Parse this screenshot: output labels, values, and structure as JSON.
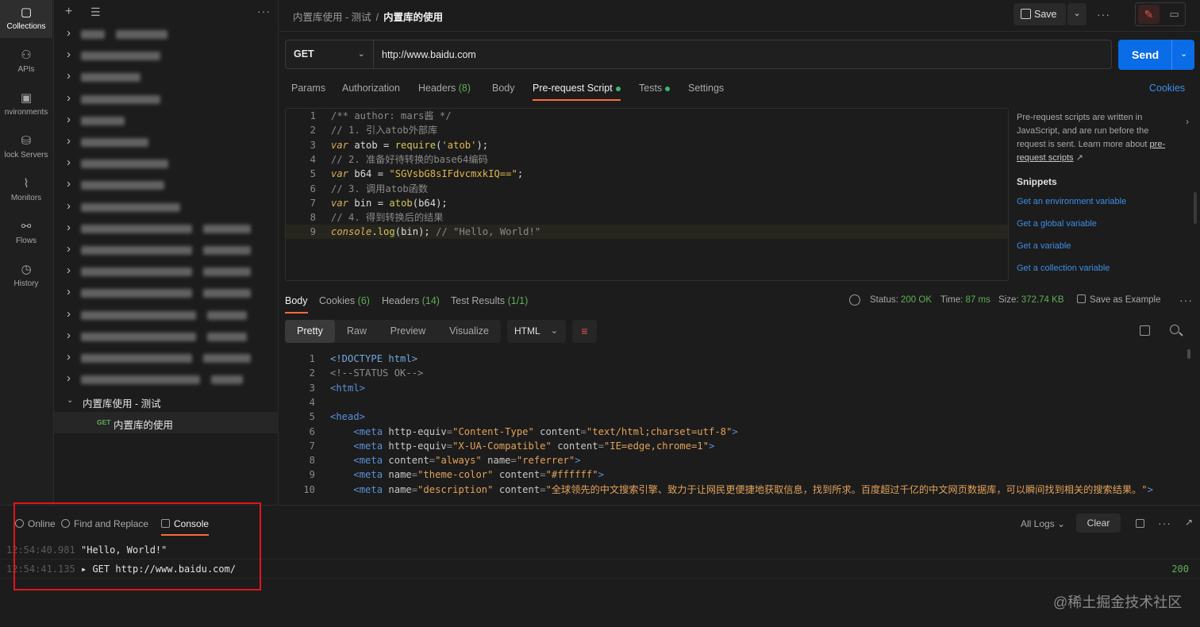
{
  "rail": [
    {
      "label": "Collections",
      "icon": "collections-icon",
      "active": true
    },
    {
      "label": "APIs",
      "icon": "apis-icon"
    },
    {
      "label": "nvironments",
      "icon": "environments-icon"
    },
    {
      "label": "lock Servers",
      "icon": "mock-servers-icon"
    },
    {
      "label": "Monitors",
      "icon": "monitors-icon"
    },
    {
      "label": "Flows",
      "icon": "flows-icon"
    },
    {
      "label": "History",
      "icon": "history-icon"
    }
  ],
  "sidebar": {
    "collection_name": "内置库使用 - 测试",
    "request": {
      "method": "GET",
      "name": "内置库的使用"
    }
  },
  "header": {
    "breadcrumb_parent": "内置库使用 - 测试",
    "breadcrumb_sep": "/",
    "breadcrumb_current": "内置库的使用",
    "save_label": "Save"
  },
  "request": {
    "method": "GET",
    "url": "http://www.baidu.com",
    "send_label": "Send",
    "tabs": [
      {
        "label": "Params"
      },
      {
        "label": "Authorization"
      },
      {
        "label": "Headers",
        "count": "(8)"
      },
      {
        "label": "Body"
      },
      {
        "label": "Pre-request Script",
        "active": true,
        "dot": true
      },
      {
        "label": "Tests",
        "dot": true
      },
      {
        "label": "Settings"
      }
    ],
    "cookies_label": "Cookies"
  },
  "script_lines": [
    {
      "n": "1",
      "parts": [
        [
          "c-com",
          "/** author: mars酱 */"
        ]
      ]
    },
    {
      "n": "2",
      "parts": [
        [
          "c-com",
          "// 1. 引入atob外部库"
        ]
      ]
    },
    {
      "n": "3",
      "parts": [
        [
          "c-kw",
          "var"
        ],
        [
          "c-def",
          " atob = "
        ],
        [
          "c-fn",
          "require"
        ],
        [
          "c-def",
          "("
        ],
        [
          "c-str",
          "'atob'"
        ],
        [
          "c-def",
          ");"
        ]
      ]
    },
    {
      "n": "4",
      "parts": [
        [
          "c-com",
          "// 2. 准备好待转换的base64编码"
        ]
      ]
    },
    {
      "n": "5",
      "parts": [
        [
          "c-kw",
          "var"
        ],
        [
          "c-def",
          " b64 = "
        ],
        [
          "c-str",
          "\"SGVsbG8sIFdvcmxkIQ==\""
        ],
        [
          "c-def",
          ";"
        ]
      ]
    },
    {
      "n": "6",
      "parts": [
        [
          "c-com",
          "// 3. 调用atob函数"
        ]
      ]
    },
    {
      "n": "7",
      "parts": [
        [
          "c-kw",
          "var"
        ],
        [
          "c-def",
          " bin = "
        ],
        [
          "c-fn",
          "atob"
        ],
        [
          "c-def",
          "(b64);"
        ]
      ]
    },
    {
      "n": "8",
      "parts": [
        [
          "c-com",
          "// 4. 得到转换后的结果"
        ]
      ]
    },
    {
      "n": "9",
      "parts": [
        [
          "c-kw",
          "console"
        ],
        [
          "c-def",
          "."
        ],
        [
          "c-fn",
          "log"
        ],
        [
          "c-def",
          "(bin); "
        ],
        [
          "c-com",
          "// \"Hello, World!\""
        ]
      ],
      "hl": true
    }
  ],
  "help": {
    "text": "Pre-request scripts are written in JavaScript, and are run before the request is sent. Learn more about",
    "link": "pre-request scripts",
    "snippets_title": "Snippets",
    "snippets": [
      "Get an environment variable",
      "Get a global variable",
      "Get a variable",
      "Get a collection variable"
    ]
  },
  "response": {
    "tabs": [
      {
        "label": "Body",
        "active": true
      },
      {
        "label": "Cookies",
        "count": "(6)"
      },
      {
        "label": "Headers",
        "count": "(14)"
      },
      {
        "label": "Test Results",
        "count": "(1/1)"
      }
    ],
    "status_label": "Status:",
    "status_value": "200 OK",
    "time_label": "Time:",
    "time_value": "87 ms",
    "size_label": "Size:",
    "size_value": "372.74 KB",
    "save_example": "Save as Example",
    "formats": [
      "Pretty",
      "Raw",
      "Preview",
      "Visualize"
    ],
    "language": "HTML"
  },
  "response_lines": [
    {
      "n": "1",
      "parts": [
        [
          "h-doc",
          "<!DOCTYPE html>"
        ]
      ]
    },
    {
      "n": "2",
      "parts": [
        [
          "h-com",
          "<!--STATUS OK-->"
        ]
      ]
    },
    {
      "n": "3",
      "parts": [
        [
          "h-tag",
          "<html>"
        ]
      ]
    },
    {
      "n": "4",
      "parts": []
    },
    {
      "n": "5",
      "parts": [
        [
          "h-tag",
          "<head>"
        ]
      ]
    },
    {
      "n": "6",
      "parts": [
        [
          "h-punc",
          "    "
        ],
        [
          "h-tag",
          "<meta "
        ],
        [
          "h-attr",
          "http-equiv"
        ],
        [
          "h-punc",
          "="
        ],
        [
          "h-val",
          "\"Content-Type\""
        ],
        [
          "h-attr",
          " content"
        ],
        [
          "h-punc",
          "="
        ],
        [
          "h-val",
          "\"text/html;charset=utf-8\""
        ],
        [
          "h-tag",
          ">"
        ]
      ]
    },
    {
      "n": "7",
      "parts": [
        [
          "h-punc",
          "    "
        ],
        [
          "h-tag",
          "<meta "
        ],
        [
          "h-attr",
          "http-equiv"
        ],
        [
          "h-punc",
          "="
        ],
        [
          "h-val",
          "\"X-UA-Compatible\""
        ],
        [
          "h-attr",
          " content"
        ],
        [
          "h-punc",
          "="
        ],
        [
          "h-val",
          "\"IE=edge,chrome=1\""
        ],
        [
          "h-tag",
          ">"
        ]
      ]
    },
    {
      "n": "8",
      "parts": [
        [
          "h-punc",
          "    "
        ],
        [
          "h-tag",
          "<meta "
        ],
        [
          "h-attr",
          "content"
        ],
        [
          "h-punc",
          "="
        ],
        [
          "h-val",
          "\"always\""
        ],
        [
          "h-attr",
          " name"
        ],
        [
          "h-punc",
          "="
        ],
        [
          "h-val",
          "\"referrer\""
        ],
        [
          "h-tag",
          ">"
        ]
      ]
    },
    {
      "n": "9",
      "parts": [
        [
          "h-punc",
          "    "
        ],
        [
          "h-tag",
          "<meta "
        ],
        [
          "h-attr",
          "name"
        ],
        [
          "h-punc",
          "="
        ],
        [
          "h-val",
          "\"theme-color\""
        ],
        [
          "h-attr",
          " content"
        ],
        [
          "h-punc",
          "="
        ],
        [
          "h-val",
          "\"#ffffff\""
        ],
        [
          "h-tag",
          ">"
        ]
      ]
    },
    {
      "n": "10",
      "parts": [
        [
          "h-punc",
          "    "
        ],
        [
          "h-tag",
          "<meta "
        ],
        [
          "h-attr",
          "name"
        ],
        [
          "h-punc",
          "="
        ],
        [
          "h-val",
          "\"description\""
        ],
        [
          "h-attr",
          " content"
        ],
        [
          "h-punc",
          "="
        ],
        [
          "h-val",
          "\"全球领先的中文搜索引擎、致力于让网民更便捷地获取信息，找到所求。百度超过千亿的中文网页数据库，可以瞬间找到相关的搜索结果。\""
        ],
        [
          "h-tag",
          ">"
        ]
      ]
    }
  ],
  "console": {
    "tabs": [
      "Online",
      "Find and Replace",
      "Console"
    ],
    "all_logs": "All Logs",
    "clear": "Clear",
    "logs": [
      {
        "time": "12:54:40.981",
        "message": "\"Hello, World!\""
      },
      {
        "time": "12:54:41.135",
        "message": "▸ GET http://www.baidu.com/",
        "status": "200"
      }
    ]
  },
  "watermark": "@稀土掘金技术社区",
  "colors": {
    "accent": "#ff6c37",
    "send": "#0a6ce6",
    "ok": "#5fae56",
    "highlight_box": "#e3141c"
  }
}
